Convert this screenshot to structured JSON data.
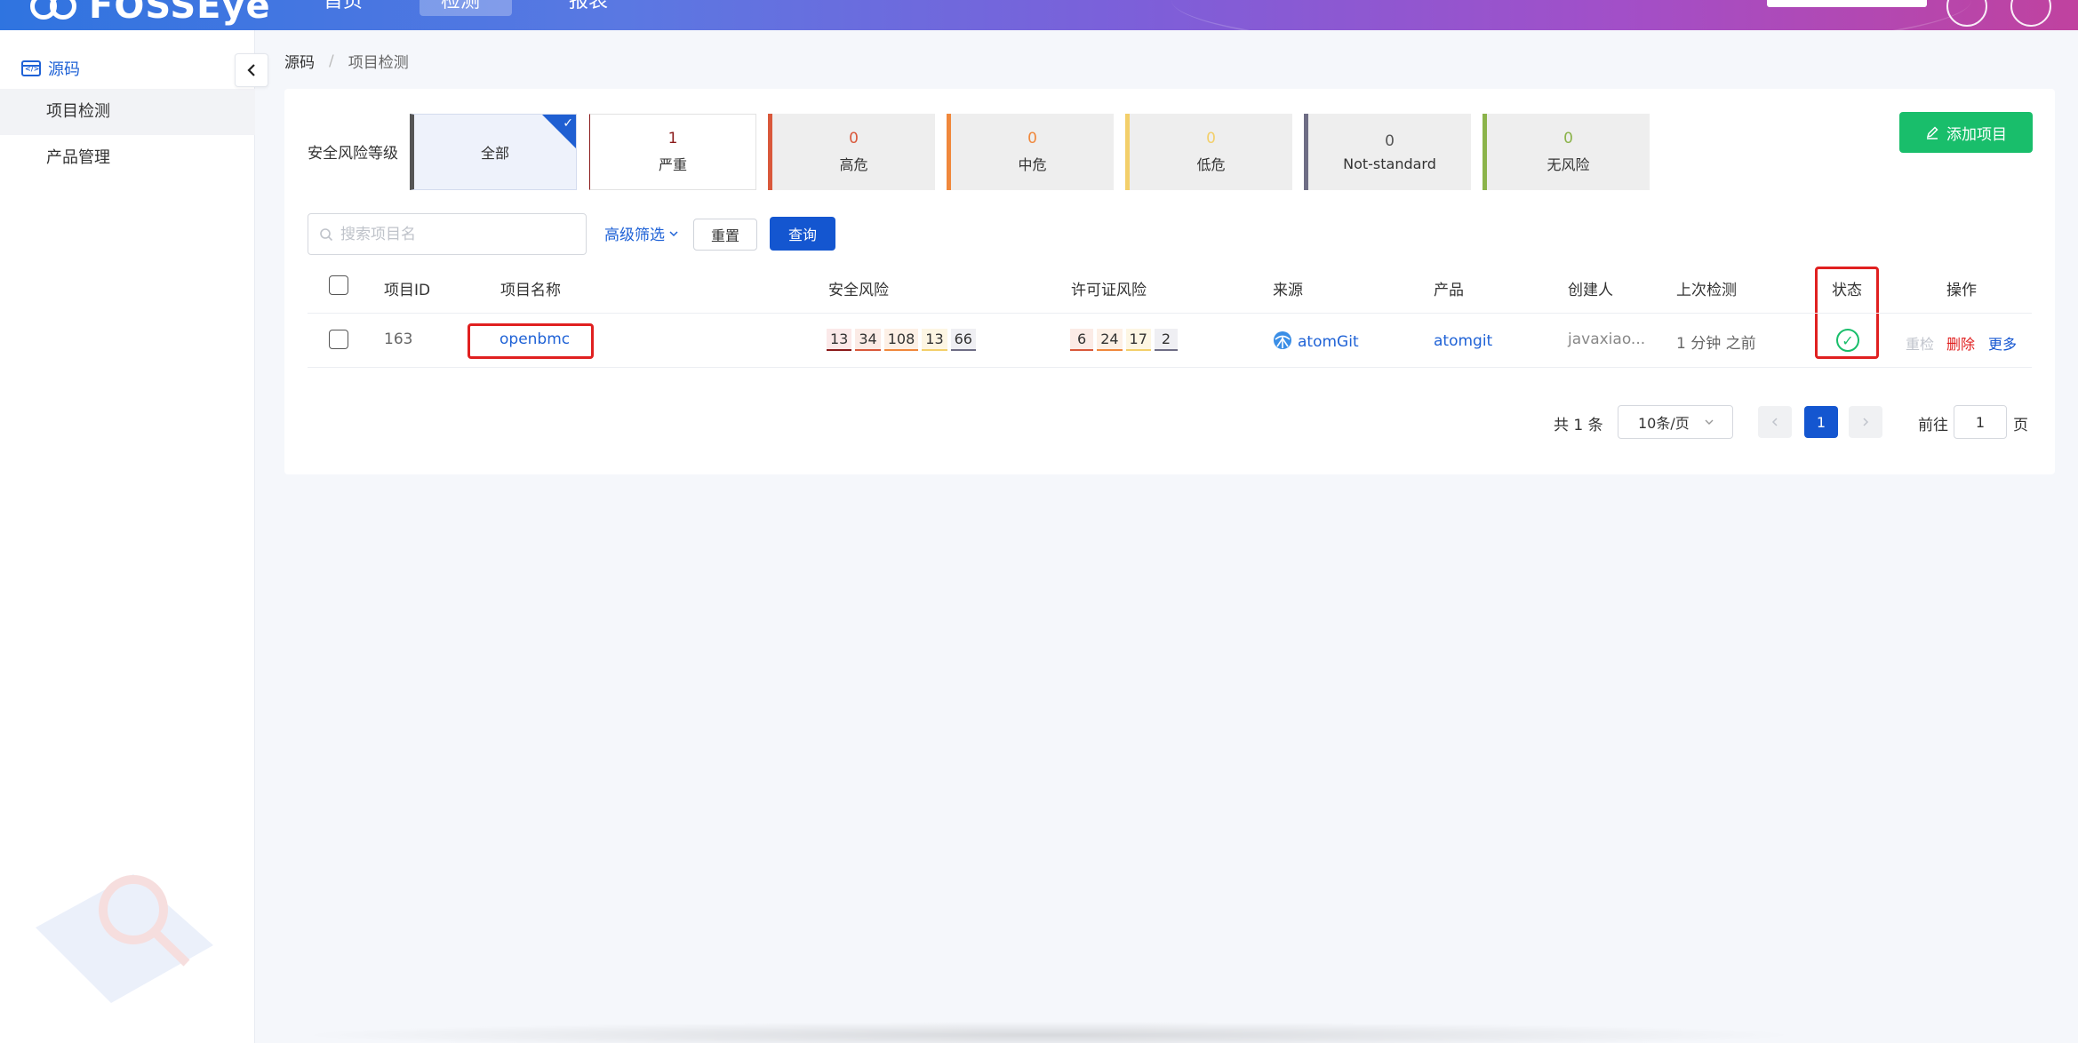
{
  "header": {
    "app_name": "FOSSEye",
    "nav": [
      "首页",
      "检测",
      "报表"
    ]
  },
  "sidebar": {
    "section": "源码",
    "items": [
      {
        "label": "项目检测",
        "active": true
      },
      {
        "label": "产品管理",
        "active": false
      }
    ]
  },
  "breadcrumb": [
    "源码",
    "项目检测"
  ],
  "filter": {
    "risk_label": "安全风险等级",
    "tiles": [
      {
        "count": "",
        "label": "全部",
        "color": "#555555",
        "selected": true
      },
      {
        "count": "1",
        "label": "严重",
        "color": "#8b1a1a"
      },
      {
        "count": "0",
        "label": "高危",
        "color": "#d9583b"
      },
      {
        "count": "0",
        "label": "中危",
        "color": "#f0883c"
      },
      {
        "count": "0",
        "label": "低危",
        "color": "#f3cf6a"
      },
      {
        "count": "0",
        "label": "Not-standard",
        "color": "#6e6d85"
      },
      {
        "count": "0",
        "label": "无风险",
        "color": "#8bb34a"
      }
    ],
    "add_button": "添加项目",
    "search_placeholder": "搜索项目名",
    "advanced": "高级筛选",
    "reset": "重置",
    "query": "查询"
  },
  "table": {
    "columns": [
      "项目ID",
      "项目名称",
      "安全风险",
      "许可证风险",
      "来源",
      "产品",
      "创建人",
      "上次检测",
      "状态",
      "操作"
    ],
    "rows": [
      {
        "id": "163",
        "name": "openbmc",
        "security_risk": [
          "13",
          "34",
          "108",
          "13",
          "66"
        ],
        "license_risk": [
          "6",
          "24",
          "17",
          "2"
        ],
        "source": "atomGit",
        "product": "atomgit",
        "creator": "javaxiao...",
        "last_check": "1 分钟 之前",
        "status": "success",
        "actions": [
          "重检",
          "删除",
          "更多"
        ]
      }
    ]
  },
  "pagination": {
    "total": "共 1 条",
    "page_size": "10条/页",
    "current": "1",
    "goto_label": "前往",
    "goto_value": "1",
    "page_suffix": "页"
  },
  "colors": {
    "primary": "#1456d0",
    "success": "#19be6b",
    "danger": "#e02020"
  }
}
